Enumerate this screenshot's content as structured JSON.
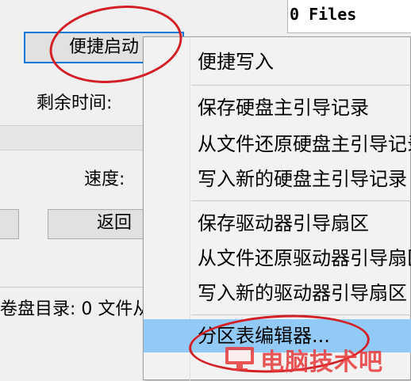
{
  "dialog": {
    "files_header": "0 Files",
    "quick_launch_button": "便捷启动",
    "remaining_time_label": "剩余时间:",
    "speed_label": "速度:",
    "back_button": "返回",
    "status_text": "卷盘目录: 0 文件从"
  },
  "menu": {
    "items": [
      {
        "label": "便捷写入"
      },
      {
        "label": "保存硬盘主引导记录"
      },
      {
        "label": "从文件还原硬盘主引导记录"
      },
      {
        "label": "写入新的硬盘主引导记录"
      },
      {
        "label": "保存驱动器引导扇区"
      },
      {
        "label": "从文件还原驱动器引导扇区"
      },
      {
        "label": "写入新的驱动器引导扇区"
      },
      {
        "label": "分区表编辑器..."
      }
    ]
  },
  "watermark": {
    "text": "电脑技术吧"
  },
  "colors": {
    "selection": "#91c9f7",
    "annotation": "#d32027",
    "watermark": "#e83a3a",
    "focus_border": "#0078d7"
  }
}
